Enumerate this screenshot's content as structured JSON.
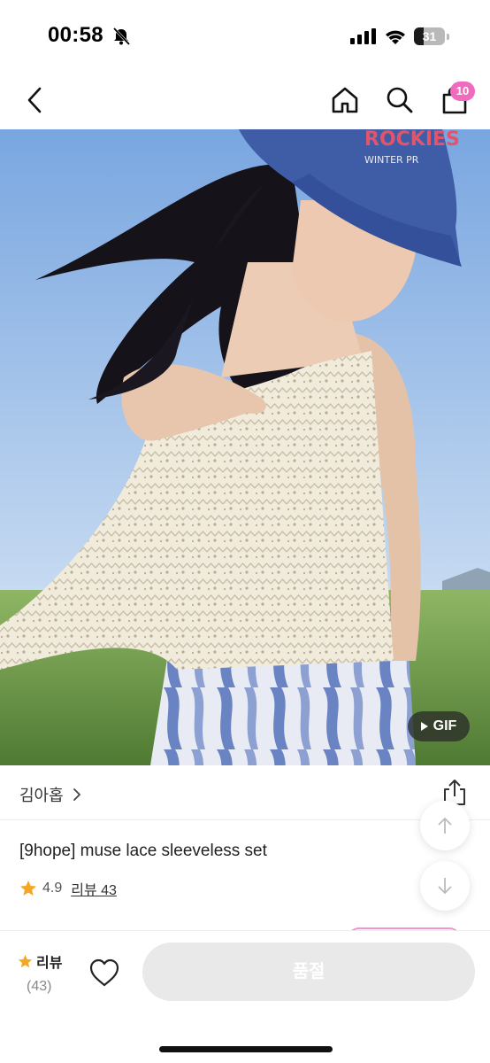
{
  "status_bar": {
    "time": "00:58",
    "battery": "31"
  },
  "nav": {
    "cart_badge": "10",
    "icons": [
      "back-arrow-icon",
      "home-icon",
      "search-icon",
      "cart-icon"
    ]
  },
  "hero": {
    "gif_label": "GIF",
    "cap_text_1": "ROCKIES",
    "cap_text_2": "WINTER PR"
  },
  "product": {
    "seller": "김아홉",
    "title": "[9hope] muse lace sleeveless set",
    "rating": "4.9",
    "review_link": "리뷰 43"
  },
  "bottom_bar": {
    "review_label": "리뷰",
    "review_count": "(43)",
    "soldout_label": "품절"
  },
  "colors": {
    "accent_pink": "#f06bbd",
    "star": "#f5a623",
    "sky": "#8fb6e6",
    "field": "#6f9a4a"
  }
}
